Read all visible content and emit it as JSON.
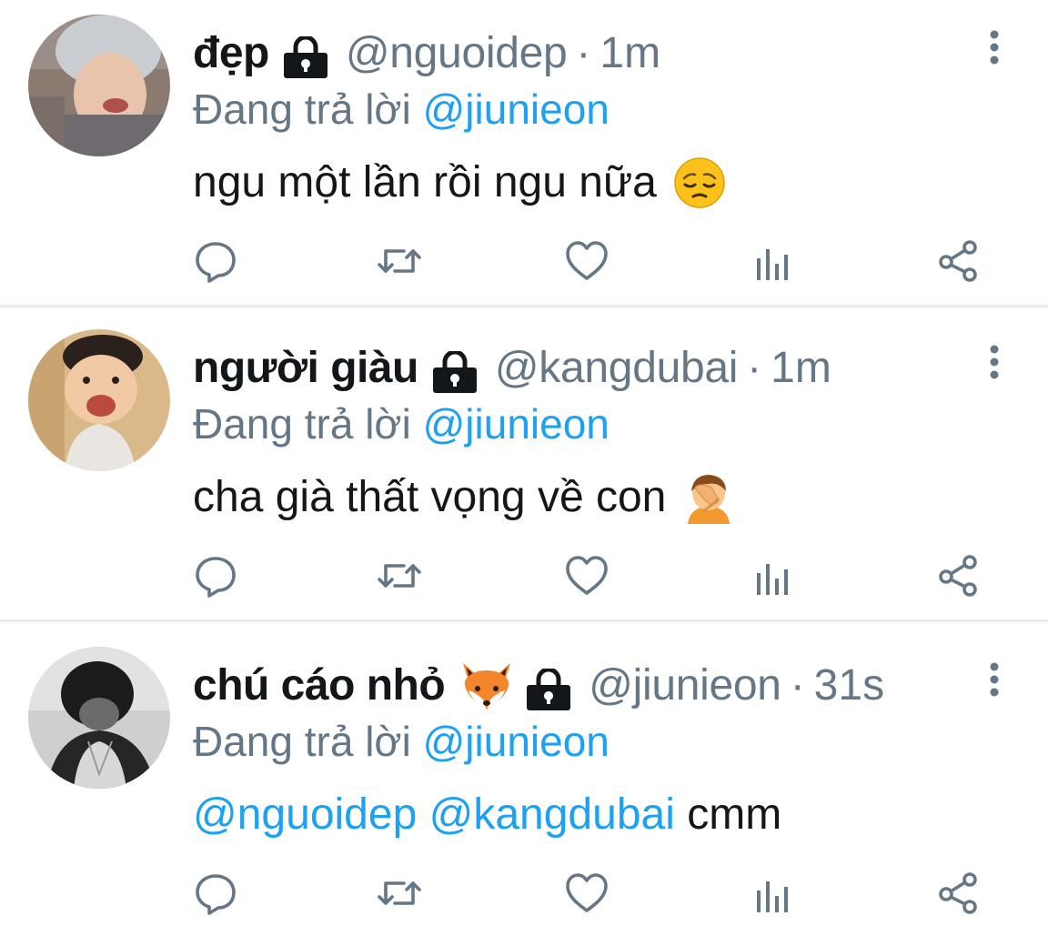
{
  "colors": {
    "text": "#14171a",
    "secondary": "#657786",
    "link": "#1da1f2",
    "divider": "#e6ecf0"
  },
  "tweets": [
    {
      "name": "đẹp",
      "handle": "@nguoidep",
      "separator": "·",
      "time": "1m",
      "replying_label": "Đang trả lời",
      "replying_to": "@jiunieon",
      "text": "ngu một lần rồi ngu nữa",
      "emoji": "pensive-face",
      "protected": true
    },
    {
      "name": "người giàu",
      "handle": "@kangdubai",
      "separator": "·",
      "time": "1m",
      "replying_label": "Đang trả lời",
      "replying_to": "@jiunieon",
      "text": "cha già thất vọng về con",
      "emoji": "facepalm",
      "protected": true
    },
    {
      "name": "chú cáo nhỏ",
      "name_emoji": "fox-face",
      "handle": "@jiunieon",
      "separator": "·",
      "time": "31s",
      "replying_label": "Đang trả lời",
      "replying_to": "@jiunieon",
      "mention_1": "@nguoidep",
      "mention_2": "@kangdubai",
      "text": "cmm",
      "protected": true
    }
  ]
}
